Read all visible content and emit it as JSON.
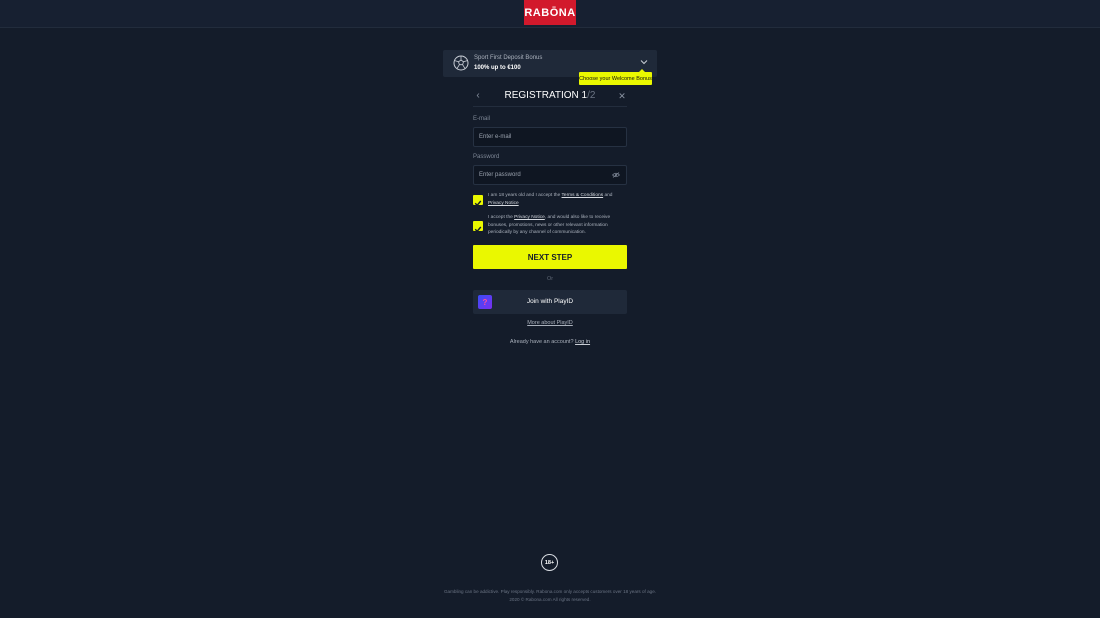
{
  "header": {
    "logo_text": "RABŌNA"
  },
  "bonus": {
    "title": "Sport First Deposit Bonus",
    "amount": "100% up to €100",
    "tooltip": "Choose your Welcome Bonus"
  },
  "registration": {
    "title_main": "REGISTRATION 1",
    "title_sep": "/",
    "title_total": "2",
    "email_label": "E-mail",
    "email_placeholder": "Enter e-mail",
    "password_label": "Password",
    "password_placeholder": "Enter password",
    "consent1": {
      "text_before": "I am 18 years old and I accept the ",
      "terms_link": "Terms & Conditions",
      "text_mid": " and ",
      "privacy_link": "Privacy Notice"
    },
    "consent2": {
      "text_before": "I accept the ",
      "privacy_link": "Privacy Notice",
      "text_after": ", and would also like to receive bonuses, promotions, news or other relevant information periodically by any channel of communication."
    },
    "next_label": "NEXT STEP",
    "or_label": "Or",
    "playid_label": "Join with PlayID",
    "playid_icon": "?",
    "more_playid": "More about PlayID",
    "login_prompt": "Already have an account? ",
    "login_link": "Log in"
  },
  "footer": {
    "age_badge": "18+",
    "line1": "Gambling can be addictive. Play responsibly. Rabona.com only accepts customers over 18 years of age.",
    "line2": "2020 © Rabona.com All rights reserved."
  },
  "colors": {
    "accent": "#eaf800",
    "brand": "#d2192c",
    "background": "#141c2a"
  }
}
